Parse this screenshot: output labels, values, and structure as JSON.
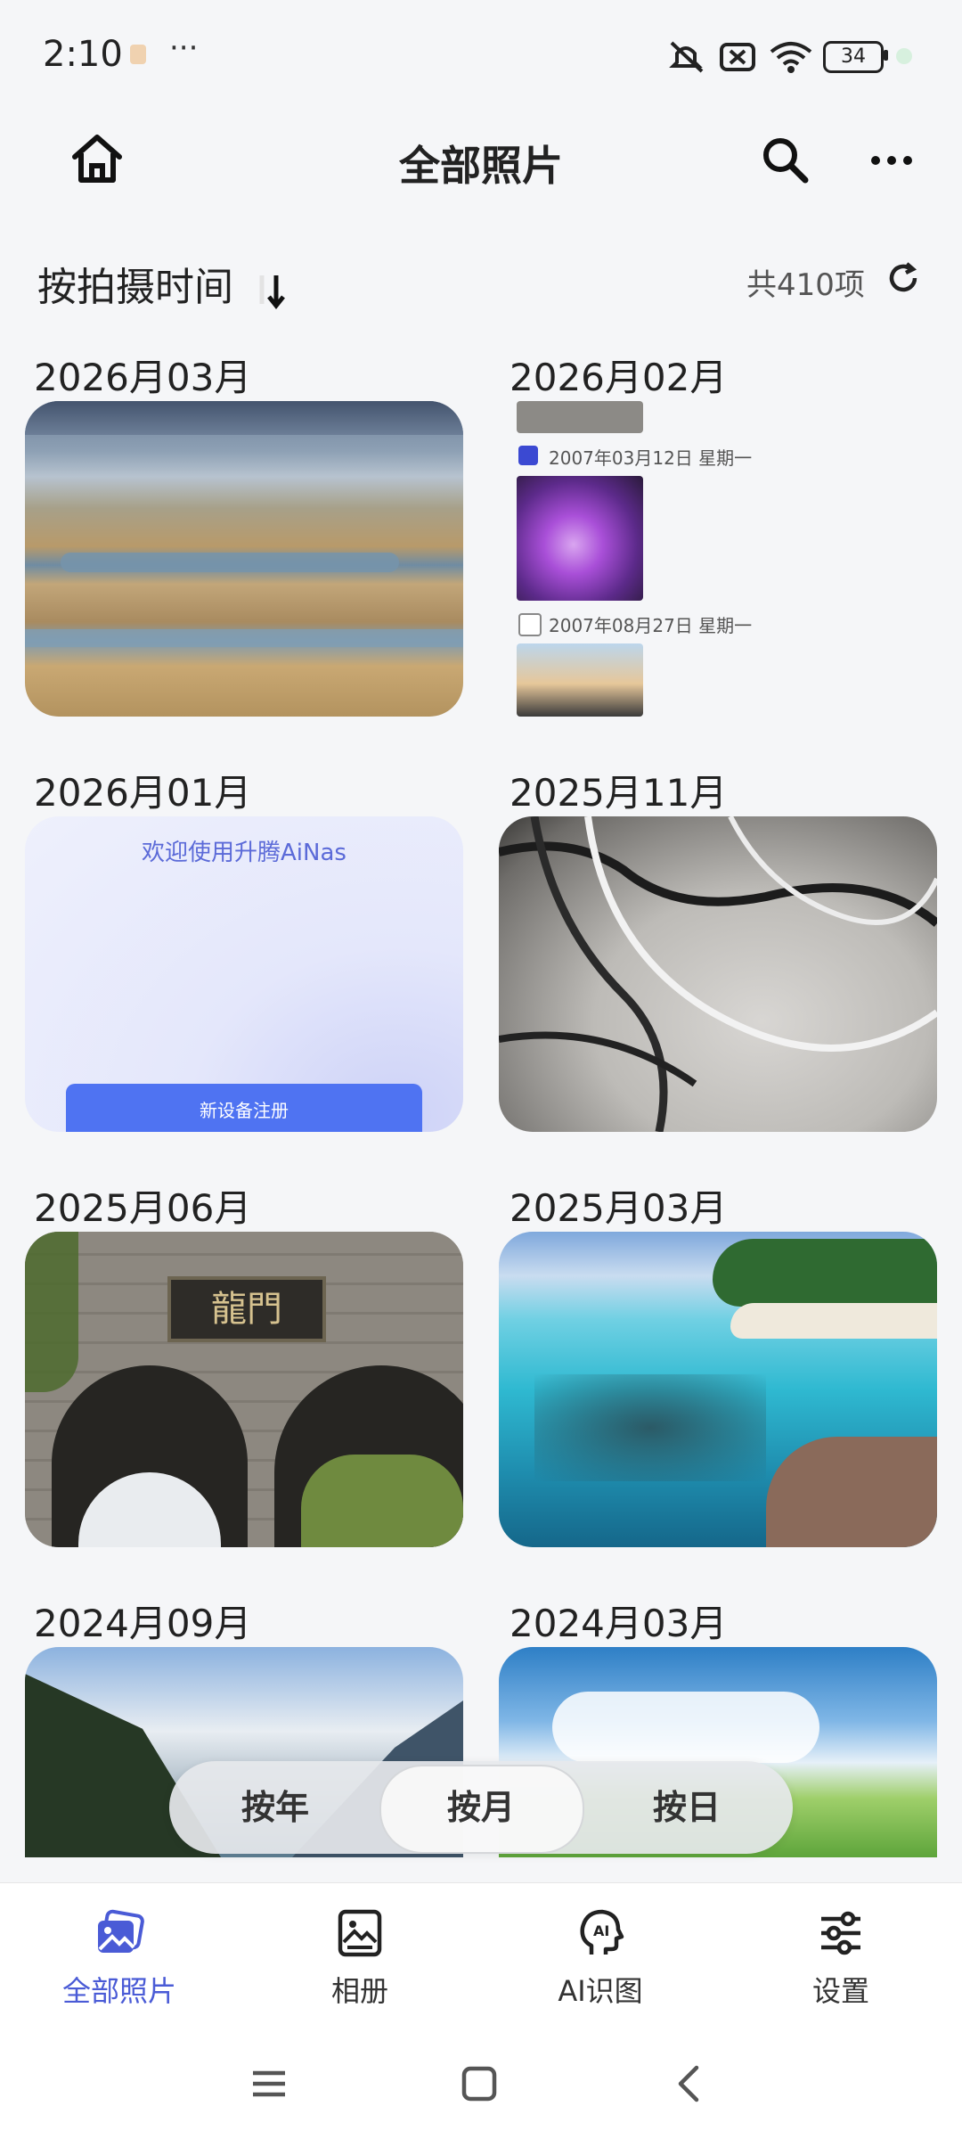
{
  "status_bar": {
    "time": "2:10",
    "more": "···",
    "battery": "34"
  },
  "header": {
    "title": "全部照片",
    "home_icon": "home-icon",
    "search_icon": "search-icon",
    "more_icon": "more-icon"
  },
  "sort": {
    "label": "按拍摄时间",
    "count": "共410项",
    "refresh_icon": "refresh-icon"
  },
  "groups": [
    {
      "date": "2026月03月",
      "thumb": "lakeside-landscape"
    },
    {
      "date": "2026月02月",
      "thumb": "screenshot-collage",
      "collage_lines": [
        "2007年03月12日 星期一",
        "2007年08月27日 星期一"
      ]
    },
    {
      "date": "2026月01月",
      "thumb": "app-welcome-screen",
      "welcome_text": "欢迎使用升腾AiNas",
      "button_text": "新设备注册"
    },
    {
      "date": "2025月11月",
      "thumb": "cables-on-desk"
    },
    {
      "date": "2025月06月",
      "thumb": "stone-gate",
      "sign_text": "龍門"
    },
    {
      "date": "2025月03月",
      "thumb": "tropical-beach"
    },
    {
      "date": "2024月09月",
      "thumb": "mountain-lake"
    },
    {
      "date": "2024月03月",
      "thumb": "green-meadow"
    }
  ],
  "view_modes": {
    "options": [
      "按年",
      "按月",
      "按日"
    ],
    "selected": "按月"
  },
  "bottom_nav": {
    "items": [
      {
        "label": "全部照片",
        "icon": "photos-icon",
        "active": true
      },
      {
        "label": "相册",
        "icon": "album-icon",
        "active": false
      },
      {
        "label": "AI识图",
        "icon": "ai-recognition-icon",
        "active": false
      },
      {
        "label": "设置",
        "icon": "settings-icon",
        "active": false
      }
    ]
  },
  "colors": {
    "accent": "#4a5bd6",
    "background": "#f5f6f8"
  }
}
